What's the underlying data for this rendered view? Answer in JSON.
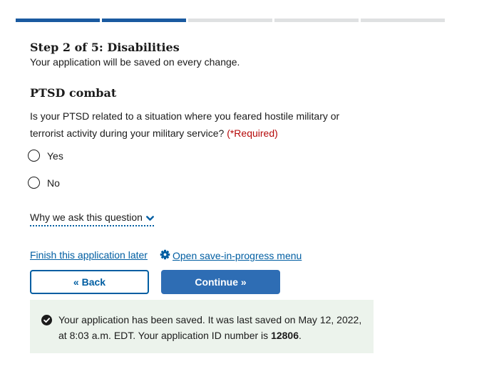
{
  "progress": {
    "total_steps": 5,
    "completed_steps": 2
  },
  "step": {
    "title": "Step 2 of 5: Disabilities",
    "subtitle": "Your application will be saved on every change."
  },
  "section": {
    "title": "PTSD combat"
  },
  "question": {
    "text": "Is your PTSD related to a situation where you feared hostile military or terrorist activity during your military service?",
    "required_label": "(*Required)",
    "options": [
      {
        "label": "Yes",
        "selected": false
      },
      {
        "label": "No",
        "selected": false
      }
    ]
  },
  "info_toggle": {
    "label": "Why we ask this question"
  },
  "save_links": {
    "finish_later": "Finish this application later",
    "open_menu": "Open save-in-progress menu"
  },
  "buttons": {
    "back": "« Back",
    "continue": "Continue »"
  },
  "alert": {
    "text_before": "Your application has been saved. It was last saved on May 12, 2022, at 8:03 a.m. EDT. Your application ID number is",
    "application_id": "12806",
    "text_after": "."
  },
  "colors": {
    "progress_active": "#1a5aa0",
    "progress_inactive": "#dfe1e2",
    "link": "#005ea2",
    "primary_button": "#2e6db4",
    "required": "#b50909",
    "success_bg": "#ecf3ec"
  },
  "icons": {
    "chevron": "chevron-down-icon",
    "gear": "gear-icon",
    "alert": "check-circle-icon"
  }
}
